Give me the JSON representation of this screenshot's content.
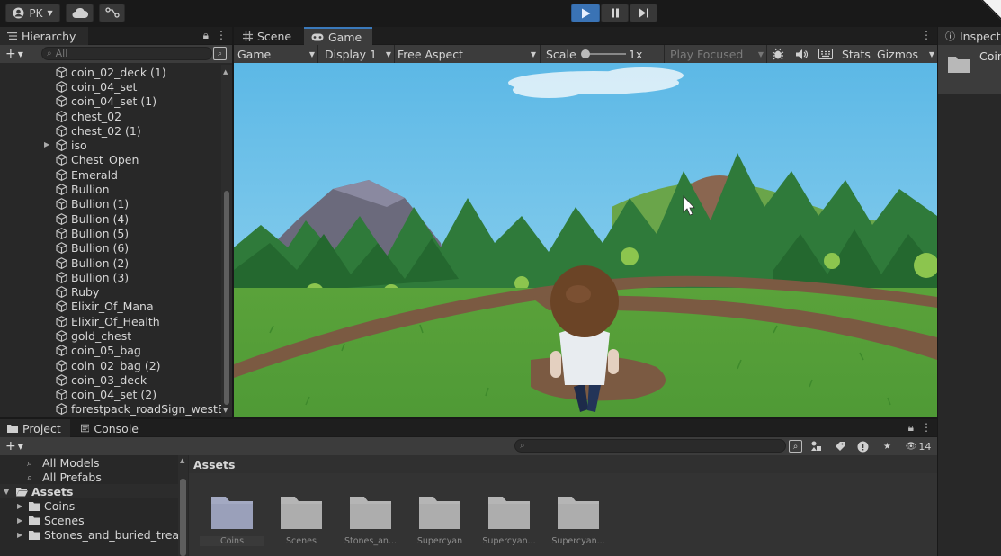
{
  "toolbar": {
    "account_label": "PK",
    "play_active": true
  },
  "hierarchy": {
    "tab_label": "Hierarchy",
    "search_placeholder": "All",
    "items": [
      {
        "label": "coin_02_deck (1)",
        "foldable": false
      },
      {
        "label": "coin_04_set",
        "foldable": false
      },
      {
        "label": "coin_04_set (1)",
        "foldable": false
      },
      {
        "label": "chest_02",
        "foldable": false
      },
      {
        "label": "chest_02 (1)",
        "foldable": false
      },
      {
        "label": "iso",
        "foldable": true
      },
      {
        "label": "Chest_Open",
        "foldable": false
      },
      {
        "label": "Emerald",
        "foldable": false
      },
      {
        "label": "Bullion",
        "foldable": false
      },
      {
        "label": "Bullion (1)",
        "foldable": false
      },
      {
        "label": "Bullion (4)",
        "foldable": false
      },
      {
        "label": "Bullion (5)",
        "foldable": false
      },
      {
        "label": "Bullion (6)",
        "foldable": false
      },
      {
        "label": "Bullion (2)",
        "foldable": false
      },
      {
        "label": "Bullion (3)",
        "foldable": false
      },
      {
        "label": "Ruby",
        "foldable": false
      },
      {
        "label": "Elixir_Of_Mana",
        "foldable": false
      },
      {
        "label": "Elixir_Of_Health",
        "foldable": false
      },
      {
        "label": "gold_chest",
        "foldable": false
      },
      {
        "label": "coin_05_bag",
        "foldable": false
      },
      {
        "label": "coin_02_bag (2)",
        "foldable": false
      },
      {
        "label": "coin_03_deck",
        "foldable": false
      },
      {
        "label": "coin_04_set (2)",
        "foldable": false
      },
      {
        "label": "forestpack_roadSign_westEas",
        "foldable": false
      }
    ]
  },
  "gameview": {
    "tabs": [
      {
        "label": "Scene",
        "active": false
      },
      {
        "label": "Game",
        "active": true
      }
    ],
    "toolbar": {
      "mode": "Game",
      "display": "Display 1",
      "aspect": "Free Aspect",
      "scale_label": "Scale",
      "scale_value": "1x",
      "play_mode": "Play Focused",
      "stats": "Stats",
      "gizmos": "Gizmos"
    }
  },
  "inspector": {
    "tab_label": "Inspect",
    "item_label": "Coin"
  },
  "project": {
    "tabs": [
      {
        "label": "Project",
        "active": true
      },
      {
        "label": "Console",
        "active": false
      }
    ],
    "hidden_count": "14",
    "tree": [
      {
        "label": "All Models",
        "type": "search",
        "indent": 0
      },
      {
        "label": "All Prefabs",
        "type": "search",
        "indent": 0
      },
      {
        "label": "Assets",
        "type": "folder-open",
        "indent": 0
      },
      {
        "label": "Coins",
        "type": "folder",
        "indent": 1
      },
      {
        "label": "Scenes",
        "type": "folder",
        "indent": 1
      },
      {
        "label": "Stones_and_buried_treasu",
        "type": "folder",
        "indent": 1
      }
    ],
    "breadcrumb": "Assets",
    "assets": [
      {
        "label": "Coins",
        "selected": true
      },
      {
        "label": "Scenes",
        "selected": false
      },
      {
        "label": "Stones_an...",
        "selected": false
      },
      {
        "label": "Supercyan",
        "selected": false
      },
      {
        "label": "Supercyan...",
        "selected": false
      },
      {
        "label": "Supercyan..."
      }
    ]
  },
  "colors": {
    "accent": "#3a79bb",
    "play_active": "#3a73b5",
    "panel_bg": "#282828",
    "toolbar_bg": "#3c3c3c"
  }
}
